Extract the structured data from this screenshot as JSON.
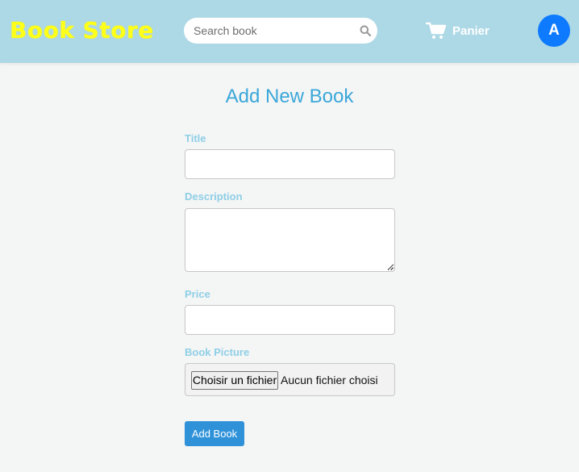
{
  "header": {
    "brand": "Book Store",
    "search_placeholder": "Search book",
    "cart_label": "Panier",
    "avatar_initial": "A"
  },
  "form": {
    "title": "Add New Book",
    "fields": {
      "title_label": "Title",
      "title_value": "",
      "description_label": "Description",
      "description_value": "",
      "price_label": "Price",
      "price_value": "",
      "picture_label": "Book Picture",
      "file_button_label": "Choisir un fichier",
      "file_status": "Aucun fichier choisi"
    },
    "submit_label": "Add Book"
  },
  "colors": {
    "navbar": "#add8e6",
    "brand": "#ffff1a",
    "avatar": "#0d7aff",
    "title": "#3aa7d9",
    "labels": "#8ecfe6",
    "button": "#2f92d9"
  }
}
